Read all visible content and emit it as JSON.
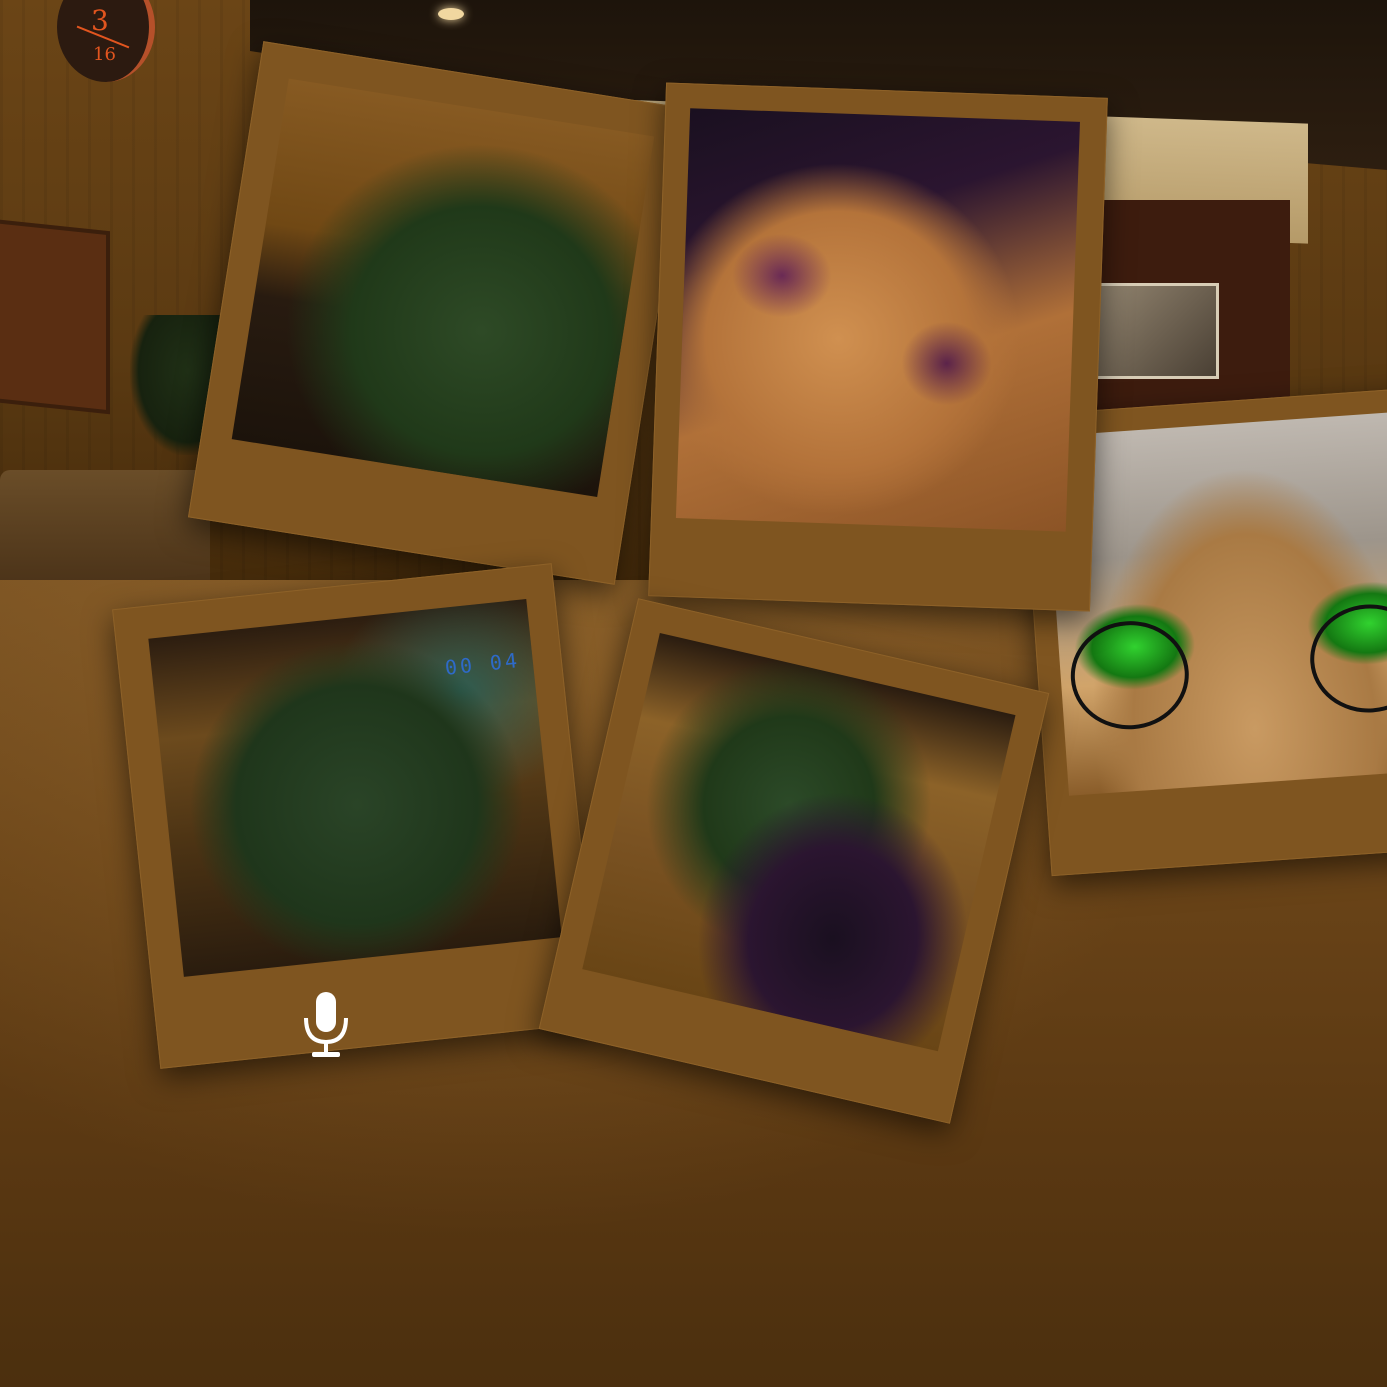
{
  "clock": {
    "numerator": "3",
    "denominator": "16"
  },
  "photos": {
    "p4": {
      "tag_text": "00 04"
    }
  },
  "colors": {
    "accent": "#e2551f",
    "mic": "#ffffff"
  },
  "icons": {
    "mic": "microphone-icon"
  }
}
